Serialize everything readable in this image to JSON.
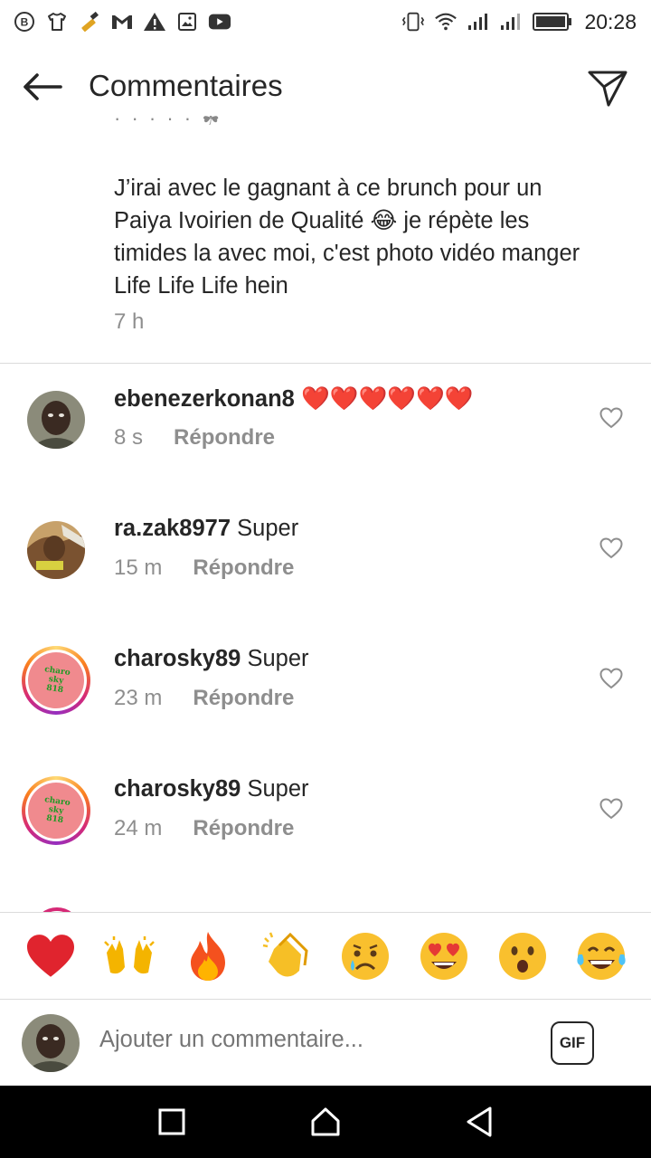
{
  "status_bar": {
    "time": "20:28",
    "left_icons": [
      "b-badge-icon",
      "tshirt-icon",
      "hammer-icon",
      "gmail-icon",
      "warning-icon",
      "image-icon",
      "youtube-icon"
    ],
    "right_icons": [
      "vibrate-icon",
      "wifi-icon",
      "signal-icon",
      "signal-2-icon",
      "battery-icon"
    ]
  },
  "header": {
    "title": "Commentaires"
  },
  "caption": {
    "text": "J’irai avec le gagnant à ce brunch  pour un Paiya Ivoirien de Qualité 😂 je répète les timides la avec moi, c'est photo vidéo manger Life Life Life hein",
    "time": "7 h"
  },
  "comments": [
    {
      "username": "ebenezerkonan8",
      "text": "❤️❤️❤️❤️❤️❤️",
      "time": "8 s",
      "reply_label": "Répondre",
      "avatar": "photo-dark",
      "story_ring": false
    },
    {
      "username": "ra.zak8977",
      "text": "Super",
      "time": "15 m",
      "reply_label": "Répondre",
      "avatar": "photo-warm",
      "story_ring": false
    },
    {
      "username": "charosky89",
      "text": "Super",
      "time": "23 m",
      "reply_label": "Répondre",
      "avatar": "logo-pink",
      "story_ring": true
    },
    {
      "username": "charosky89",
      "text": "Super",
      "time": "24 m",
      "reply_label": "Répondre",
      "avatar": "logo-pink",
      "story_ring": true
    }
  ],
  "avatar_logo_text": [
    "charo",
    "sky",
    "818"
  ],
  "reactions": [
    "❤️",
    "🙌",
    "🔥",
    "👏",
    "😢",
    "😍",
    "😮",
    "😂"
  ],
  "composer": {
    "placeholder": "Ajouter un commentaire...",
    "gif_label": "GIF"
  },
  "colors": {
    "text_primary": "#262626",
    "text_secondary": "#8e8e8e",
    "divider": "#dbdbdb",
    "story_ring": [
      "#feda75",
      "#fa7e1e",
      "#d62976",
      "#962fbf"
    ]
  }
}
